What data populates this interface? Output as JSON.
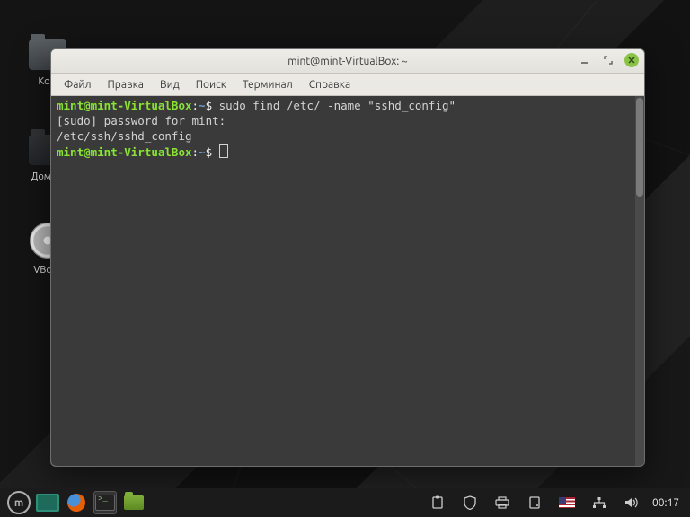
{
  "desktop": {
    "icons": [
      {
        "label": "Ком"
      },
      {
        "label": "Домаш"
      },
      {
        "label": "VBox_"
      }
    ]
  },
  "window": {
    "title": "mint@mint-VirtualBox: ~",
    "menu": [
      "Файл",
      "Правка",
      "Вид",
      "Поиск",
      "Терминал",
      "Справка"
    ]
  },
  "terminal": {
    "prompt_user": "mint@mint-VirtualBox",
    "prompt_sep": ":",
    "prompt_path": "~",
    "prompt_end": "$",
    "lines": {
      "cmd1": "sudo find /etc/ -name \"sshd_config\"",
      "out1": "[sudo] password for mint:",
      "out2": "/etc/ssh/sshd_config"
    }
  },
  "panel": {
    "clock": "00:17"
  }
}
